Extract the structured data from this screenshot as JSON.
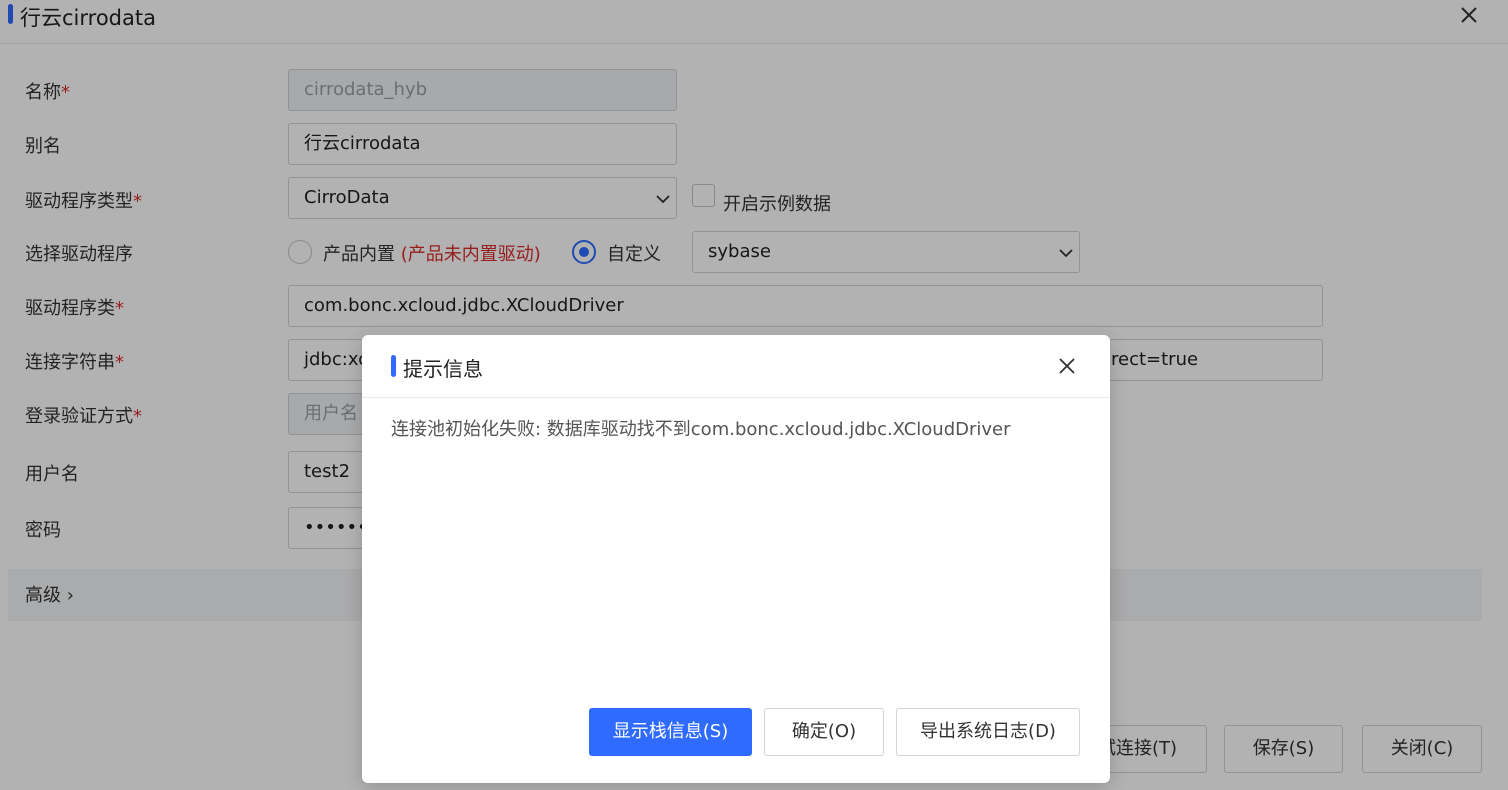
{
  "window": {
    "title": "行云cirrodata"
  },
  "form": {
    "name": {
      "label": "名称",
      "required": "*",
      "value": "cirrodata_hyb"
    },
    "alias": {
      "label": "别名",
      "value": "行云cirrodata"
    },
    "driver_type": {
      "label": "驱动程序类型",
      "required": "*",
      "value": "CirroData",
      "checkbox_label": "开启示例数据"
    },
    "driver_select": {
      "label": "选择驱动程序",
      "option_builtin": "产品内置",
      "builtin_warning": "(产品未内置驱动)",
      "option_custom": "自定义",
      "custom_value": "sybase",
      "selected": "custom"
    },
    "driver_class": {
      "label": "驱动程序类",
      "required": "*",
      "value": "com.bonc.xcloud.jdbc.XCloudDriver"
    },
    "conn_string": {
      "label": "连接字符串",
      "required": "*",
      "value_start": "jdbc:xc",
      "value_end": "rect=true"
    },
    "auth_method": {
      "label": "登录验证方式",
      "required": "*",
      "value": "用户名"
    },
    "username": {
      "label": "用户名",
      "value": "test2"
    },
    "password": {
      "label": "密码",
      "value": "•••••••"
    },
    "advanced": {
      "label": "高级",
      "chevron": "›"
    }
  },
  "footer_buttons": {
    "test": "试连接(T)",
    "save": "保存(S)",
    "close": "关闭(C)"
  },
  "modal": {
    "title": "提示信息",
    "message": "连接池初始化失败: 数据库驱动找不到com.bonc.xcloud.jdbc.XCloudDriver",
    "buttons": {
      "stack": "显示栈信息(S)",
      "ok": "确定(O)",
      "export": "导出系统日志(D)"
    }
  },
  "colors": {
    "accent": "#2f6bff",
    "required": "#d92b2b"
  },
  "icons": {
    "close": "close-icon",
    "dropdown": "chevron-down-icon"
  }
}
